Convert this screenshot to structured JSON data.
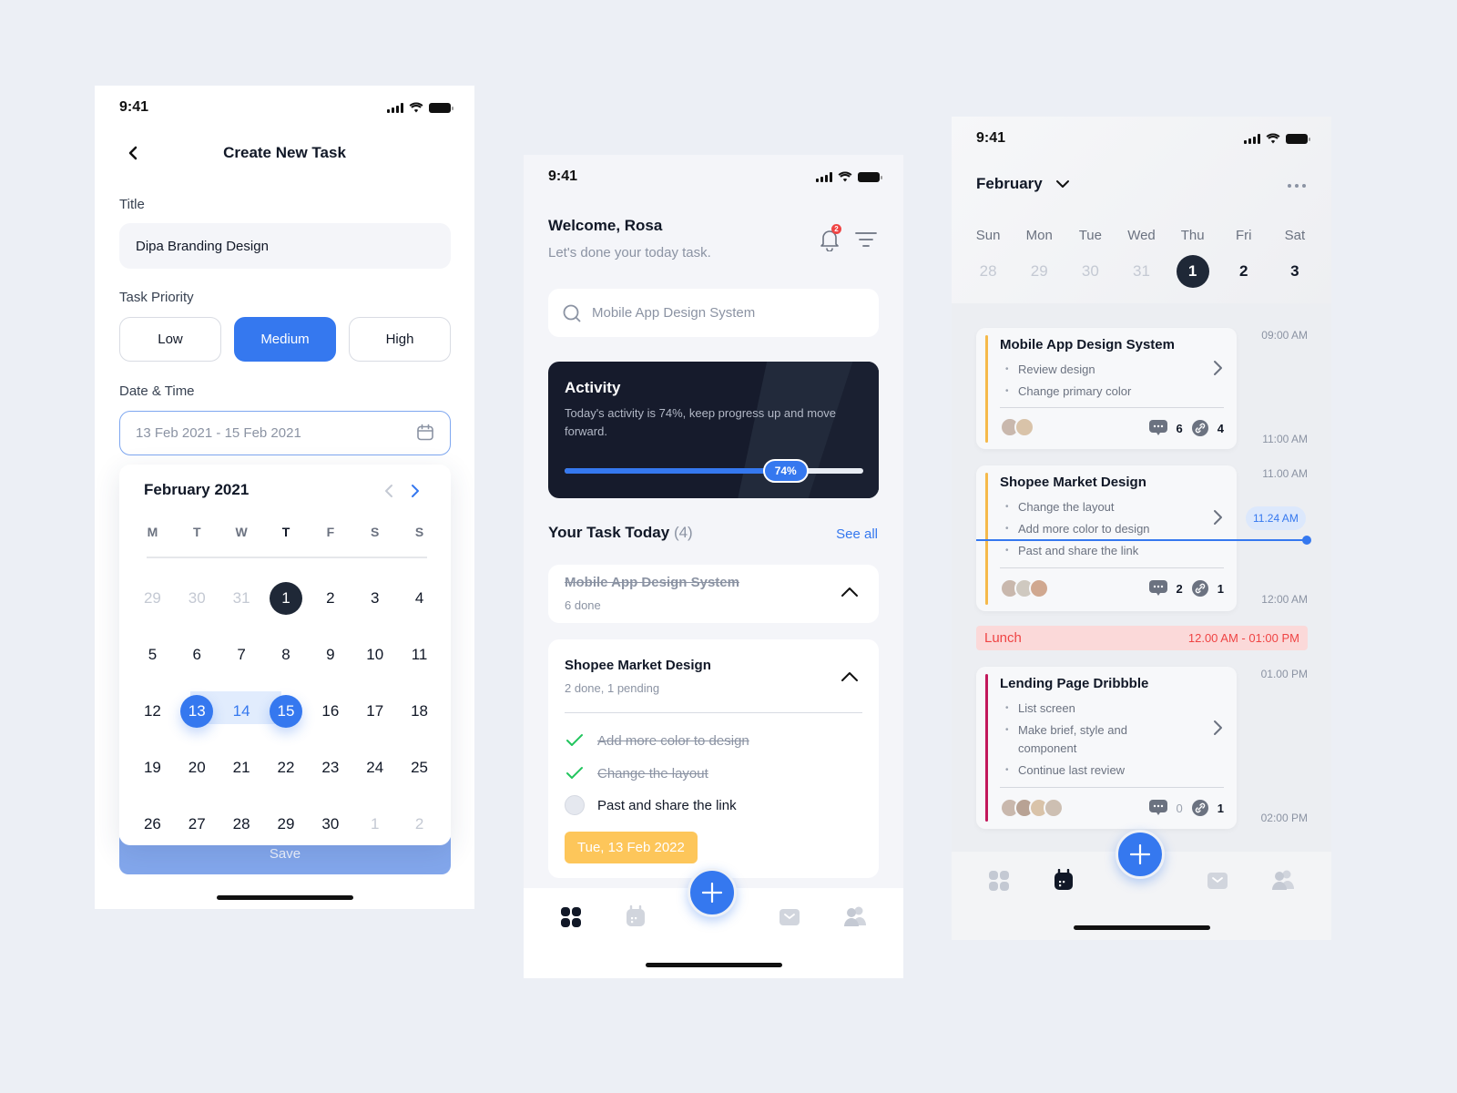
{
  "status_bar": {
    "time": "9:41"
  },
  "create_task": {
    "title": "Create New Task",
    "title_label": "Title",
    "title_value": "Dipa Branding Design",
    "priority_label": "Task Priority",
    "priorities": [
      {
        "label": "Low",
        "selected": false
      },
      {
        "label": "Medium",
        "selected": true
      },
      {
        "label": "High",
        "selected": false
      }
    ],
    "datetime_label": "Date & Time",
    "date_range_value": "13 Feb 2021 - 15 Feb 2021",
    "save_label": "Save",
    "calendar": {
      "month_label": "February 2021",
      "weekdays": [
        "M",
        "T",
        "W",
        "T",
        "F",
        "S",
        "S"
      ],
      "today_weekday_index": 3,
      "days": [
        {
          "n": "29",
          "state": "muted"
        },
        {
          "n": "30",
          "state": "muted"
        },
        {
          "n": "31",
          "state": "muted"
        },
        {
          "n": "1",
          "state": "today"
        },
        {
          "n": "2",
          "state": ""
        },
        {
          "n": "3",
          "state": ""
        },
        {
          "n": "4",
          "state": ""
        },
        {
          "n": "5",
          "state": ""
        },
        {
          "n": "6",
          "state": ""
        },
        {
          "n": "7",
          "state": ""
        },
        {
          "n": "8",
          "state": ""
        },
        {
          "n": "9",
          "state": ""
        },
        {
          "n": "10",
          "state": ""
        },
        {
          "n": "11",
          "state": ""
        },
        {
          "n": "12",
          "state": ""
        },
        {
          "n": "13",
          "state": "sel"
        },
        {
          "n": "14",
          "state": "inrange"
        },
        {
          "n": "15",
          "state": "sel"
        },
        {
          "n": "16",
          "state": ""
        },
        {
          "n": "17",
          "state": ""
        },
        {
          "n": "18",
          "state": ""
        },
        {
          "n": "19",
          "state": ""
        },
        {
          "n": "20",
          "state": ""
        },
        {
          "n": "21",
          "state": ""
        },
        {
          "n": "22",
          "state": ""
        },
        {
          "n": "23",
          "state": ""
        },
        {
          "n": "24",
          "state": ""
        },
        {
          "n": "25",
          "state": ""
        },
        {
          "n": "26",
          "state": ""
        },
        {
          "n": "27",
          "state": ""
        },
        {
          "n": "28",
          "state": ""
        },
        {
          "n": "29",
          "state": ""
        },
        {
          "n": "30",
          "state": ""
        },
        {
          "n": "1",
          "state": "muted"
        },
        {
          "n": "2",
          "state": "muted"
        }
      ]
    }
  },
  "home": {
    "welcome": "Welcome, Rosa",
    "subtitle": "Let's done your today task.",
    "notification_count": "2",
    "search_placeholder": "Mobile App Design System",
    "activity": {
      "title": "Activity",
      "description": "Today's activity is 74%, keep progress up and move forward.",
      "progress_percent": 74,
      "progress_label": "74%"
    },
    "tasks_heading": "Your Task Today",
    "tasks_count": "(4)",
    "see_all": "See all",
    "tasks": [
      {
        "name": "Mobile App Design System",
        "status": "6 done",
        "completed": true
      },
      {
        "name": "Shopee Market Design",
        "status": "2 done, 1 pending",
        "completed": false,
        "subtasks": [
          {
            "label": "Add more color to design",
            "done": true
          },
          {
            "label": "Change the layout",
            "done": true
          },
          {
            "label": "Past and share the link",
            "done": false
          }
        ],
        "date": "Tue, 13 Feb 2022"
      }
    ],
    "colors": {
      "accent": "#3578EF",
      "date_chip": "#FDC65A",
      "check": "#22C55E"
    }
  },
  "schedule": {
    "month": "February",
    "weekdays": [
      "Sun",
      "Mon",
      "Tue",
      "Wed",
      "Thu",
      "Fri",
      "Sat"
    ],
    "week_days": [
      {
        "n": "28",
        "state": "muted"
      },
      {
        "n": "29",
        "state": "muted"
      },
      {
        "n": "30",
        "state": "muted"
      },
      {
        "n": "31",
        "state": "muted"
      },
      {
        "n": "1",
        "state": "today"
      },
      {
        "n": "2",
        "state": ""
      },
      {
        "n": "3",
        "state": ""
      }
    ],
    "events": [
      {
        "title": "Mobile App Design System",
        "items": [
          "Review design",
          "Change primary color"
        ],
        "comments": "6",
        "links": "4",
        "bar_color": "#F5B94A"
      },
      {
        "title": "Shopee Market Design",
        "items": [
          "Change the layout",
          "Add more color to design",
          "Past and share the link"
        ],
        "comments": "2",
        "links": "1",
        "bar_color": "#F5B94A"
      },
      {
        "title": "Lending Page Dribbble",
        "items": [
          "List screen",
          "Make brief, style and component",
          "Continue last review"
        ],
        "comments": "0",
        "links": "1",
        "bar_color": "#C2185B"
      }
    ],
    "time_labels": [
      "09:00 AM",
      "11:00 AM",
      "11.00 AM",
      "12:00 AM",
      "01.00 PM",
      "02:00 PM"
    ],
    "now_label": "11.24 AM",
    "lunch": {
      "label": "Lunch",
      "time": "12.00 AM  -  01:00 PM"
    }
  }
}
